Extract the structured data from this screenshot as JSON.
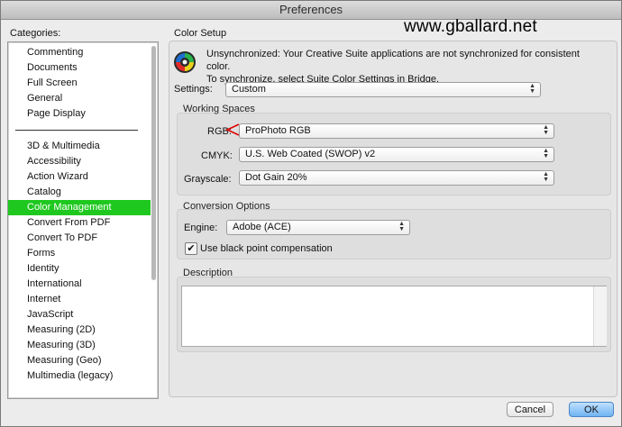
{
  "window": {
    "title": "Preferences"
  },
  "watermark": "www.gballard.net",
  "categories": {
    "label": "Categories:",
    "group1": [
      "Commenting",
      "Documents",
      "Full Screen",
      "General",
      "Page Display"
    ],
    "group2": [
      "3D & Multimedia",
      "Accessibility",
      "Action Wizard",
      "Catalog",
      "Color Management",
      "Convert From PDF",
      "Convert To PDF",
      "Forms",
      "Identity",
      "International",
      "Internet",
      "JavaScript",
      "Measuring (2D)",
      "Measuring (3D)",
      "Measuring (Geo)",
      "Multimedia (legacy)"
    ],
    "selected": "Color Management"
  },
  "color_setup": {
    "label": "Color Setup",
    "sync_line1": "Unsynchronized: Your Creative Suite applications are not synchronized for consistent color.",
    "sync_line2": "To synchronize, select Suite Color Settings in Bridge.",
    "settings_label": "Settings:",
    "settings_value": "Custom"
  },
  "working_spaces": {
    "title": "Working Spaces",
    "rgb_label": "RGB:",
    "rgb_value": "ProPhoto RGB",
    "cmyk_label": "CMYK:",
    "cmyk_value": "U.S. Web Coated (SWOP) v2",
    "grayscale_label": "Grayscale:",
    "grayscale_value": "Dot Gain 20%"
  },
  "conversion": {
    "title": "Conversion Options",
    "engine_label": "Engine:",
    "engine_value": "Adobe (ACE)",
    "bpc_label": "Use black point compensation",
    "bpc_checked": true
  },
  "description": {
    "title": "Description",
    "text": ""
  },
  "buttons": {
    "cancel": "Cancel",
    "ok": "OK"
  },
  "colors": {
    "selection": "#1fc81f",
    "ok_button": "#6fb3f2",
    "arrow": "#e00000"
  }
}
